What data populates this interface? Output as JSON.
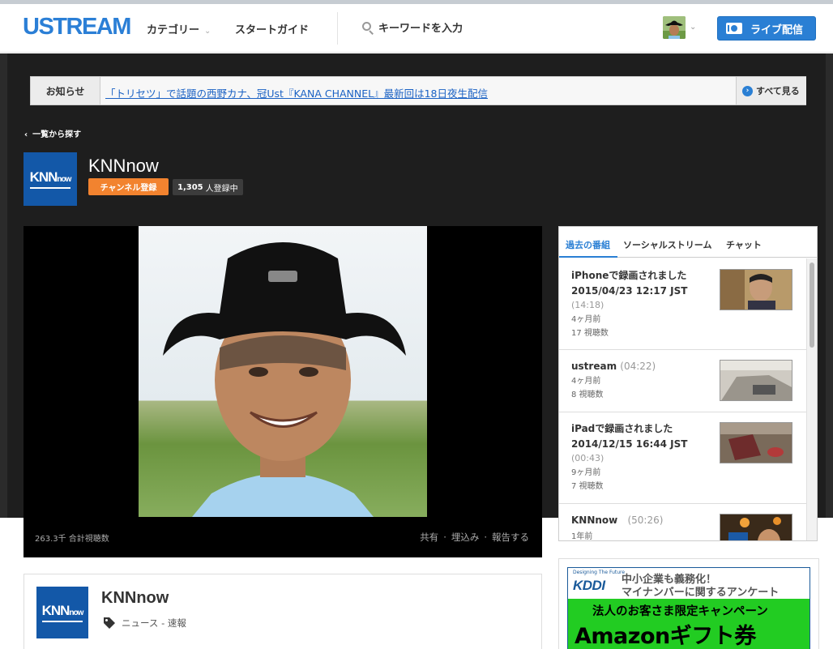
{
  "header": {
    "logo": "USTREAM",
    "nav_category": "カテゴリー",
    "nav_guide": "スタートガイド",
    "search_placeholder": "キーワードを入力",
    "live_button": "ライブ配信"
  },
  "notice": {
    "label": "お知らせ",
    "text": "「トリセツ」で話題の西野カナ、冠Ust『KANA CHANNEL』最新回は18日夜生配信",
    "see_all": "すべて見る"
  },
  "back_link": "一覧から探す",
  "channel": {
    "logo_text": "KNN",
    "logo_sub": "now",
    "title": "KNNnow",
    "subscribe_button": "チャンネル登録",
    "subscriber_count": "1,305",
    "subscriber_suffix": "人登録中"
  },
  "player": {
    "total_views": "263.3千 合計視聴数",
    "actions": [
      "共有",
      "埋込み",
      "報告する"
    ]
  },
  "side_panel": {
    "tabs": [
      "過去の番組",
      "ソーシャルストリーム",
      "チャット"
    ],
    "active_tab": 0,
    "items": [
      {
        "title": "iPhoneで録画されました 2015/04/23 12:17 JST",
        "duration": "(14:18)",
        "age": "4ヶ月前",
        "views": "17 視聴数"
      },
      {
        "title": "ustream",
        "duration": "(04:22)",
        "age": "4ヶ月前",
        "views": "8 視聴数"
      },
      {
        "title": "iPadで録画されました 2014/12/15 16:44 JST",
        "duration": "(00:43)",
        "age": "9ヶ月前",
        "views": "7 視聴数"
      },
      {
        "title": "KNNnow",
        "duration": "(50:26)",
        "age": "1年前",
        "views": ""
      }
    ]
  },
  "channel_card": {
    "title": "KNNnow",
    "category": "ニュース - 速報"
  },
  "ad": {
    "kddi_small": "Designing The Future",
    "kddi": "KDDI",
    "line1": "中小企業も義務化！",
    "line2": "マイナンバーに関するアンケート",
    "line3": "法人のお客さま限定キャンペーン",
    "line4": "Amazonギフト券"
  },
  "colors": {
    "brand_blue": "#2a7fd4",
    "subscribe_orange": "#f2832f",
    "link_blue": "#1b62c4",
    "hero_bg": "#1e1e1e",
    "ad_green": "#22cc22"
  }
}
